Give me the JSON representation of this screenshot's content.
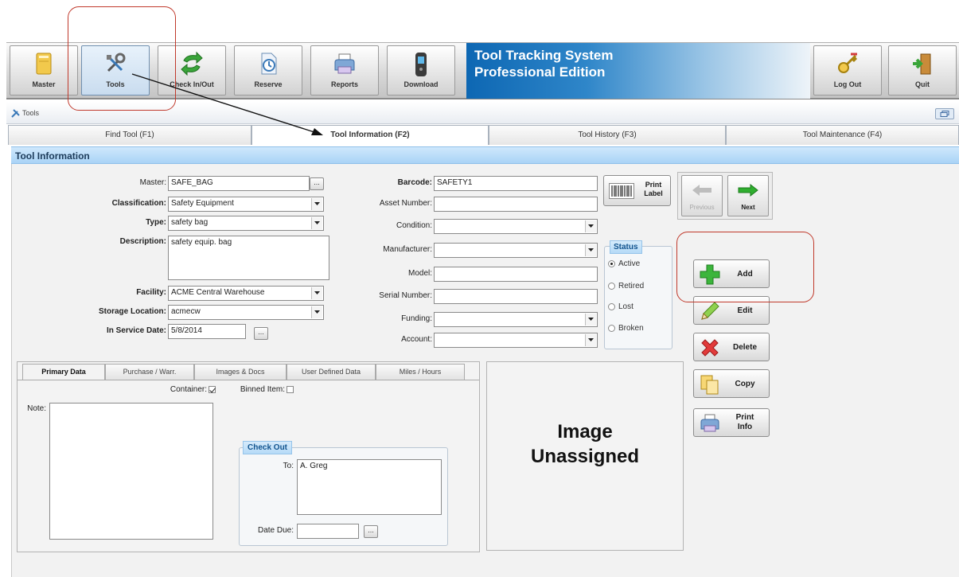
{
  "toolbar": {
    "buttons": [
      {
        "label": "Master",
        "icon": "folder-icon"
      },
      {
        "label": "Tools",
        "icon": "tools-icon"
      },
      {
        "label": "Check In/Out",
        "icon": "exchange-arrows-icon"
      },
      {
        "label": "Reserve",
        "icon": "clock-page-icon"
      },
      {
        "label": "Reports",
        "icon": "printer-icon"
      },
      {
        "label": "Download",
        "icon": "handheld-device-icon"
      },
      {
        "label": "Log Out",
        "icon": "key-icon"
      },
      {
        "label": "Quit",
        "icon": "exit-door-icon"
      }
    ],
    "brand_line1": "Tool Tracking System",
    "brand_line2": "Professional Edition"
  },
  "panel": {
    "title": "Tools"
  },
  "tabs": [
    {
      "label": "Find Tool (F1)"
    },
    {
      "label": "Tool Information (F2)"
    },
    {
      "label": "Tool History (F3)"
    },
    {
      "label": "Tool Maintenance (F4)"
    }
  ],
  "section": {
    "title": "Tool Information"
  },
  "form": {
    "master": {
      "label": "Master:",
      "value": "SAFE_BAG"
    },
    "classification": {
      "label": "Classification:",
      "value": "Safety Equipment"
    },
    "type": {
      "label": "Type:",
      "value": "safety bag"
    },
    "description": {
      "label": "Description:",
      "value": "safety equip. bag"
    },
    "facility": {
      "label": "Facility:",
      "value": "ACME Central Warehouse"
    },
    "storage_location": {
      "label": "Storage Location:",
      "value": "acmecw"
    },
    "in_service_date": {
      "label": "In Service Date:",
      "value": "5/8/2014"
    },
    "barcode": {
      "label": "Barcode:",
      "value": "SAFETY1"
    },
    "asset_number": {
      "label": "Asset Number:",
      "value": ""
    },
    "condition": {
      "label": "Condition:",
      "value": ""
    },
    "manufacturer": {
      "label": "Manufacturer:",
      "value": ""
    },
    "model": {
      "label": "Model:",
      "value": ""
    },
    "serial_number": {
      "label": "Serial Number:",
      "value": ""
    },
    "funding": {
      "label": "Funding:",
      "value": ""
    },
    "account": {
      "label": "Account:",
      "value": ""
    },
    "dots": "..."
  },
  "print_label": {
    "line1": "Print",
    "line2": "Label"
  },
  "status": {
    "title": "Status",
    "options": [
      {
        "label": "Active",
        "selected": true
      },
      {
        "label": "Retired",
        "selected": false
      },
      {
        "label": "Lost",
        "selected": false
      },
      {
        "label": "Broken",
        "selected": false
      }
    ]
  },
  "nav": {
    "previous": "Previous",
    "next": "Next"
  },
  "actions": {
    "add": "Add",
    "edit": "Edit",
    "delete": "Delete",
    "copy": "Copy",
    "print_info_line1": "Print",
    "print_info_line2": "Info"
  },
  "sub_tabs": [
    {
      "label": "Primary Data"
    },
    {
      "label": "Purchase / Warr."
    },
    {
      "label": "Images & Docs"
    },
    {
      "label": "User Defined Data"
    },
    {
      "label": "Miles / Hours"
    }
  ],
  "primary": {
    "container_label": "Container:",
    "container_checked": true,
    "binned_label": "Binned Item:",
    "binned_checked": false,
    "note_label": "Note:",
    "note_value": ""
  },
  "checkout": {
    "title": "Check Out",
    "to_label": "To:",
    "to_value": "A. Greg",
    "date_due_label": "Date Due:",
    "date_due_value": ""
  },
  "image": {
    "line1": "Image",
    "line2": "Unassigned"
  },
  "colors": {
    "annotation": "#c0392b",
    "brand": "#0d67b3",
    "section_header": "#a9d3f6"
  }
}
